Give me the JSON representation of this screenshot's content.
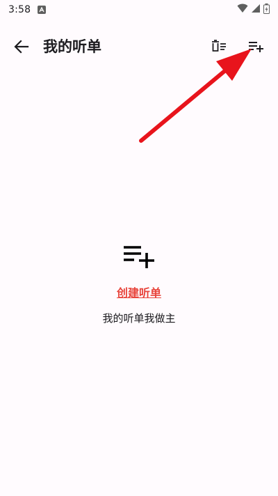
{
  "status_bar": {
    "time": "3:58",
    "notification_icon": "a-letter-icon",
    "icons": [
      "wifi-icon",
      "signal-icon",
      "battery-icon"
    ]
  },
  "app_bar": {
    "title": "我的听单",
    "back_icon": "arrow-left-icon",
    "clear_icon": "clear-list-icon",
    "add_icon": "playlist-add-icon"
  },
  "empty_state": {
    "icon": "playlist-add-icon",
    "create_label": "创建听单",
    "subtitle": "我的听单我做主"
  },
  "colors": {
    "background": "#fffbfe",
    "text": "#1c1b1f",
    "link": "#e8453c",
    "annotation": "#e8141c"
  }
}
